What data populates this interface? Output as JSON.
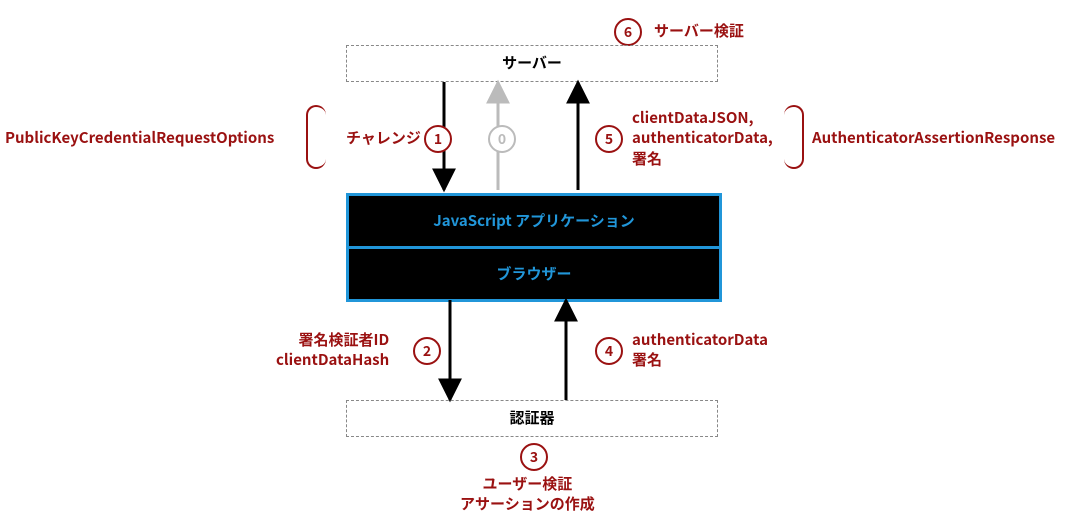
{
  "diagram": {
    "title_kind": "WebAuthn authentication flow (Japanese labels)",
    "boxes": {
      "server": "サーバー",
      "js_app": "JavaScript アプリケーション",
      "browser": "ブラウザー",
      "authenticator": "認証器"
    },
    "steps": {
      "s0": "0",
      "s1": "1",
      "s2": "2",
      "s3": "3",
      "s4": "4",
      "s5": "5",
      "s6": "6"
    },
    "labels": {
      "server_verify": "サーバー検証",
      "challenge": "チャレンジ",
      "request_options": "PublicKeyCredentialRequestOptions",
      "assertion_response": "AuthenticatorAssertionResponse",
      "rp_id": "署名検証者ID",
      "client_data_hash": "clientDataHash",
      "authenticator_data": "authenticatorData",
      "signature": "署名",
      "client_data_json": "clientDataJSON,",
      "auth_data_comma": "authenticatorData,",
      "user_verify": "ユーザー検証",
      "create_assertion": "アサーションの作成"
    }
  },
  "chart_data": {
    "type": "flow-diagram",
    "nodes": [
      {
        "id": "server",
        "label": "サーバー",
        "style": "dashed"
      },
      {
        "id": "js_app",
        "label": "JavaScript アプリケーション",
        "style": "solid-blue"
      },
      {
        "id": "browser",
        "label": "ブラウザー",
        "style": "solid-blue"
      },
      {
        "id": "authenticator",
        "label": "認証器",
        "style": "dashed"
      }
    ],
    "edges": [
      {
        "step": 0,
        "from": "js_app",
        "to": "server",
        "label": "",
        "style": "grey"
      },
      {
        "step": 1,
        "from": "server",
        "to": "js_app",
        "label": "チャレンジ",
        "group": "PublicKeyCredentialRequestOptions"
      },
      {
        "step": 2,
        "from": "browser",
        "to": "authenticator",
        "label": "署名検証者ID, clientDataHash"
      },
      {
        "step": 3,
        "at": "authenticator",
        "label": "ユーザー検証 / アサーションの作成",
        "kind": "process"
      },
      {
        "step": 4,
        "from": "authenticator",
        "to": "browser",
        "label": "authenticatorData, 署名"
      },
      {
        "step": 5,
        "from": "js_app",
        "to": "server",
        "label": "clientDataJSON, authenticatorData, 署名",
        "group": "AuthenticatorAssertionResponse"
      },
      {
        "step": 6,
        "at": "server",
        "label": "サーバー検証",
        "kind": "process"
      }
    ]
  }
}
